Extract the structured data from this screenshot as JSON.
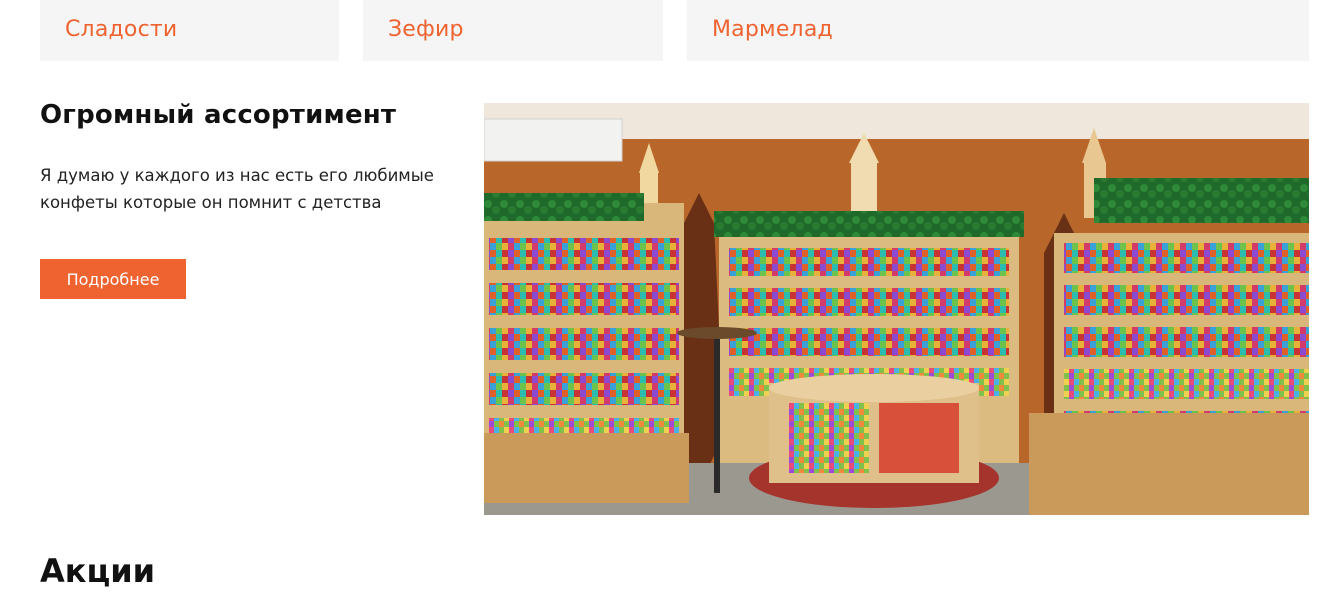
{
  "categories": [
    {
      "label": "Сладости"
    },
    {
      "label": "Зефир"
    },
    {
      "label": "Мармелад"
    }
  ],
  "promo": {
    "title": "Огромный ассортимент",
    "text": "Я думаю у каждого из нас есть его любимые конфеты которые он помнит с детства",
    "button_label": "Подробнее",
    "accent_color": "#ef6331"
  },
  "section": {
    "title": "Акции"
  }
}
